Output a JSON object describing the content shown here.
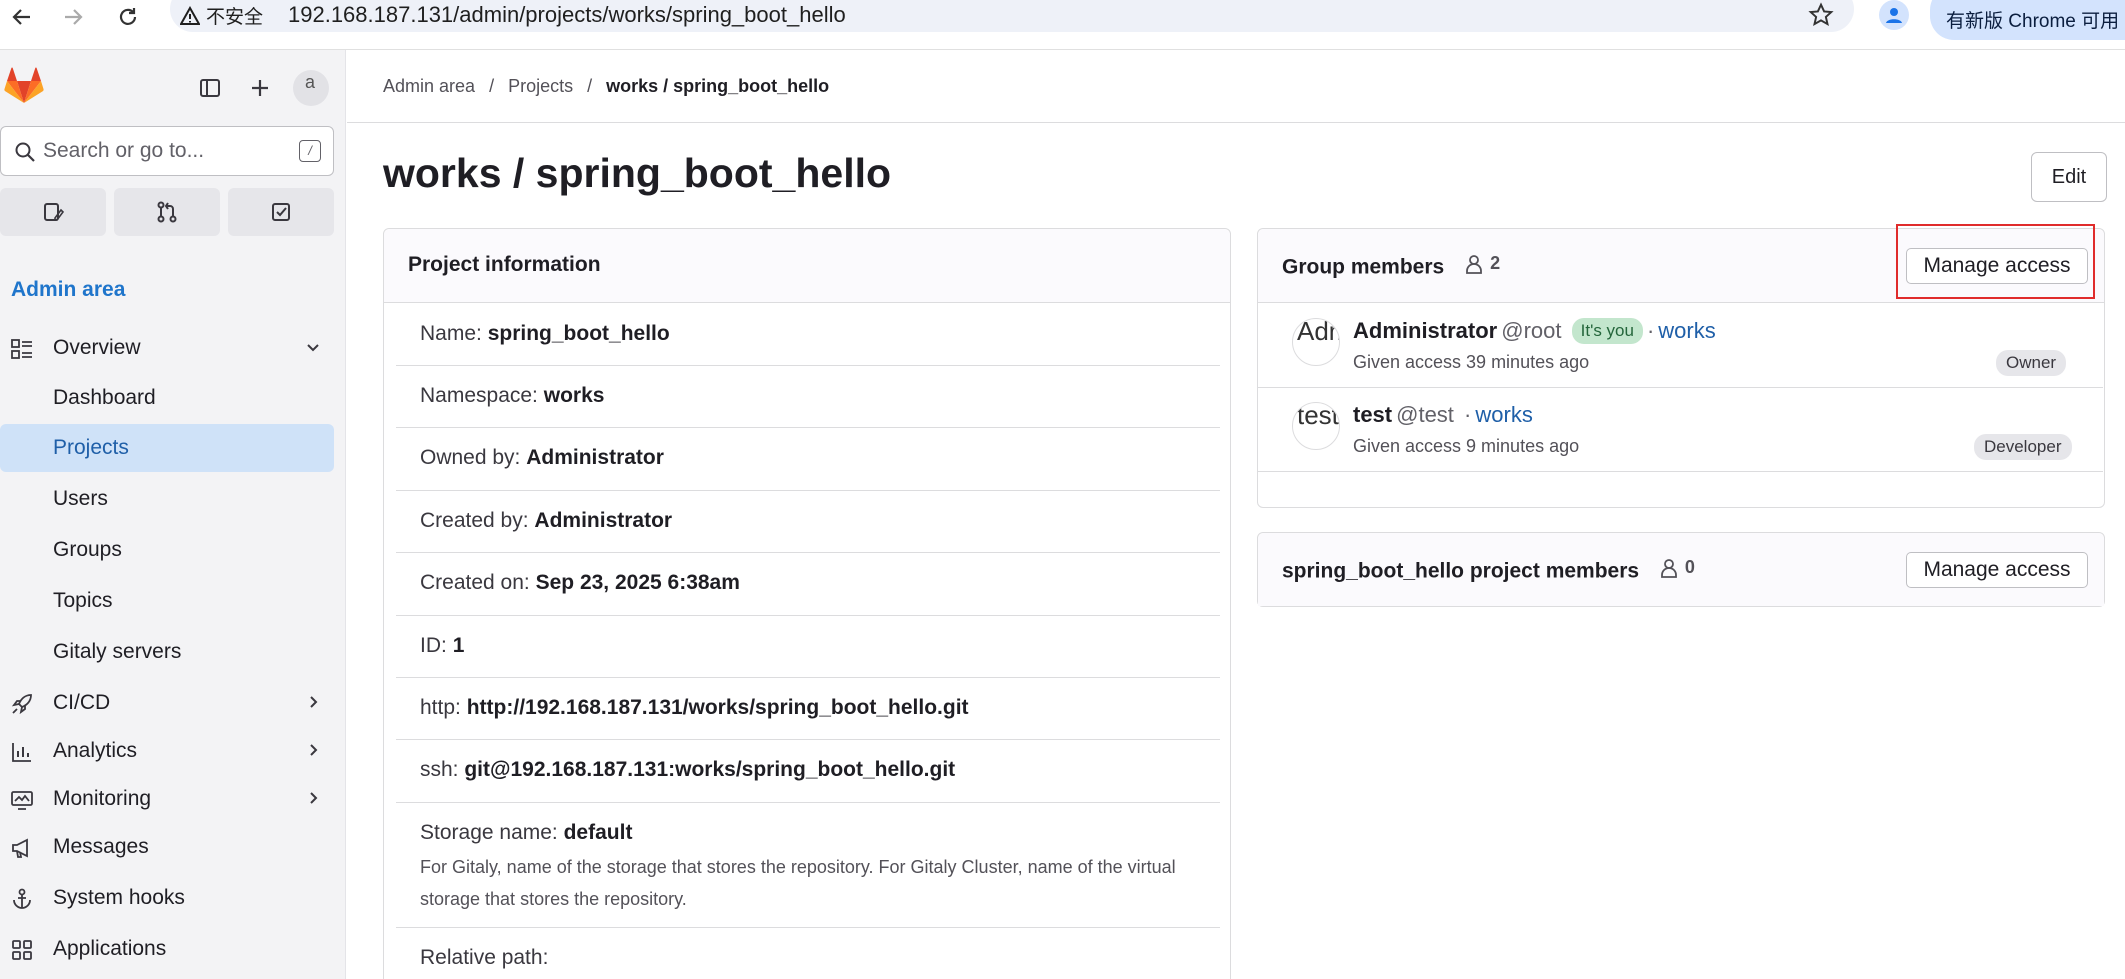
{
  "browser": {
    "security_warning": "不安全",
    "url": "192.168.187.131/admin/projects/works/spring_boot_hello",
    "update_label": "有新版 Chrome 可用"
  },
  "sidebar": {
    "avatar_text": "a",
    "search_placeholder": "Search or go to...",
    "search_shortcut": "/",
    "section_title": "Admin area",
    "items": [
      {
        "label": "Overview",
        "icon": "overview-icon"
      },
      {
        "label": "Dashboard"
      },
      {
        "label": "Projects",
        "active": true
      },
      {
        "label": "Users"
      },
      {
        "label": "Groups"
      },
      {
        "label": "Topics"
      },
      {
        "label": "Gitaly servers"
      },
      {
        "label": "CI/CD",
        "icon": "rocket-icon"
      },
      {
        "label": "Analytics",
        "icon": "chart-icon"
      },
      {
        "label": "Monitoring",
        "icon": "monitor-icon"
      },
      {
        "label": "Messages",
        "icon": "megaphone-icon"
      },
      {
        "label": "System hooks",
        "icon": "anchor-icon"
      },
      {
        "label": "Applications",
        "icon": "apps-icon"
      }
    ]
  },
  "breadcrumb": [
    "Admin area",
    "Projects",
    "works / spring_boot_hello"
  ],
  "page": {
    "title": "works / spring_boot_hello",
    "edit_label": "Edit"
  },
  "project_info": {
    "title": "Project information",
    "rows": [
      {
        "label": "Name:",
        "value": "spring_boot_hello"
      },
      {
        "label": "Namespace:",
        "value": "works"
      },
      {
        "label": "Owned by:",
        "value": "Administrator"
      },
      {
        "label": "Created by:",
        "value": "Administrator"
      },
      {
        "label": "Created on:",
        "value": "Sep 23, 2025 6:38am"
      },
      {
        "label": "ID:",
        "value": "1"
      },
      {
        "label": "http:",
        "value": "http://192.168.187.131/works/spring_boot_hello.git"
      },
      {
        "label": "ssh:",
        "value": "git@192.168.187.131:works/spring_boot_hello.git"
      },
      {
        "label": "Storage name:",
        "value": "default",
        "help": "For Gitaly, name of the storage that stores the repository. For Gitaly Cluster, name of the virtual storage that stores the repository."
      },
      {
        "label": "Relative path:",
        "value": ""
      }
    ]
  },
  "group_members": {
    "title": "Group members",
    "count": "2",
    "manage_label": "Manage access",
    "members": [
      {
        "avatar_text": "Adm",
        "name": "Administrator",
        "handle": "@root",
        "badge": "It's you",
        "group": "works",
        "given": "Given access 39 minutes ago",
        "role": "Owner"
      },
      {
        "avatar_text": "test",
        "name": "test",
        "handle": "@test",
        "badge": "",
        "group": "works",
        "given": "Given access 9 minutes ago",
        "role": "Developer"
      }
    ]
  },
  "project_members": {
    "title": "spring_boot_hello project members",
    "count": "0",
    "manage_label": "Manage access"
  }
}
